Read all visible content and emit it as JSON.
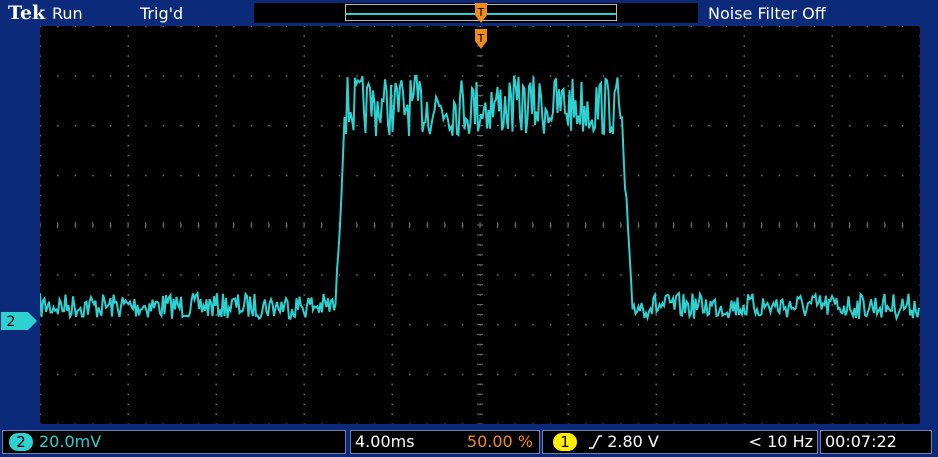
{
  "header": {
    "brand": "Tek",
    "run_state": "Run",
    "trigger_state": "Trig'd",
    "noise_filter": "Noise Filter Off"
  },
  "channel_marker": {
    "label": "2"
  },
  "footer": {
    "ch2_badge": "2",
    "ch2_scale": "20.0mV",
    "timebase": "4.00ms",
    "trigger_position": "50.00 %",
    "trig_source_badge": "1",
    "trigger_level": "2.80 V",
    "trigger_freq": "< 10 Hz",
    "clock": "00:07:22"
  },
  "colors": {
    "background": "#0b2a7a",
    "trace": "#2fd0d0",
    "trigger_marker": "#f08c1a",
    "grid": "#6e6e6e",
    "ch1_badge": "#ffee00",
    "ch2_badge": "#2fd0d0"
  }
}
